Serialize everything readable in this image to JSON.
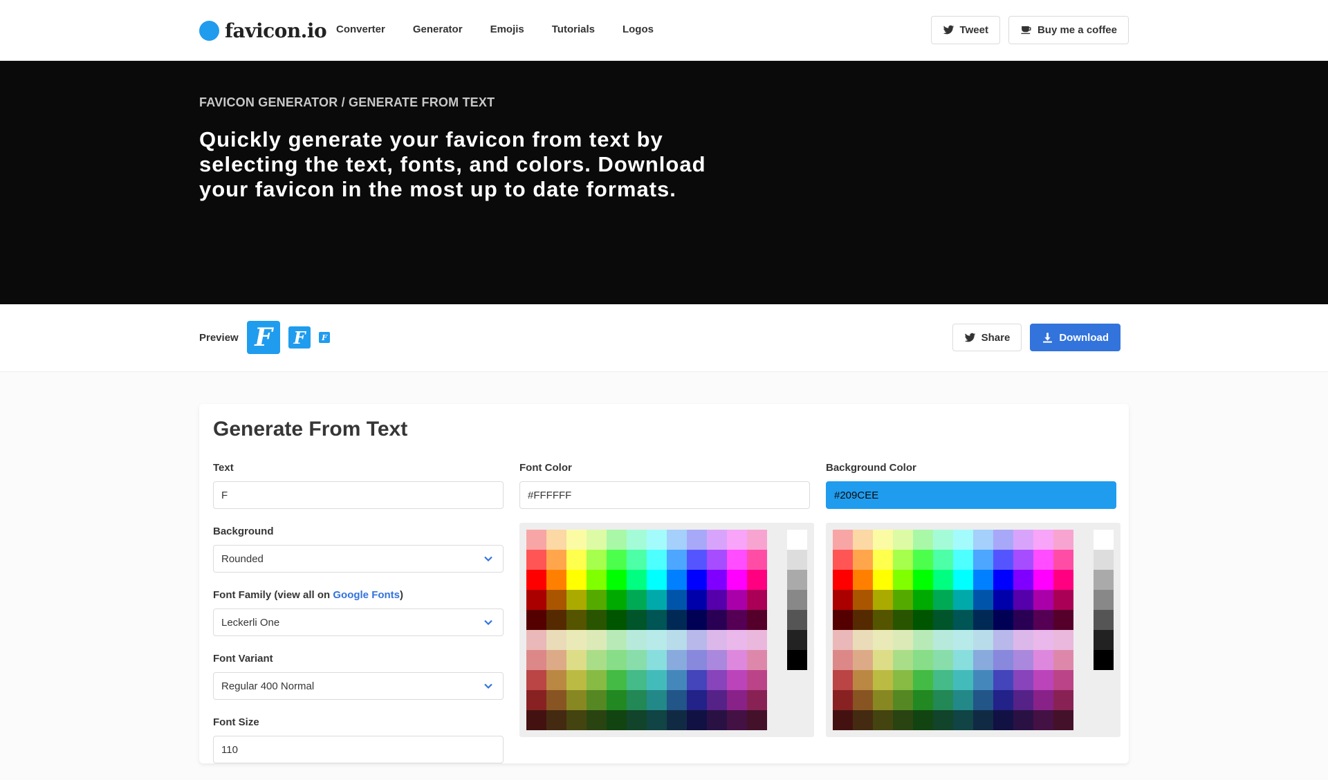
{
  "nav": {
    "brand": "favicon.io",
    "links": [
      "Converter",
      "Generator",
      "Emojis",
      "Tutorials",
      "Logos"
    ],
    "tweet": "Tweet",
    "coffee": "Buy me a coffee"
  },
  "hero": {
    "breadcrumb": "FAVICON GENERATOR / GENERATE FROM TEXT",
    "title": "Quickly generate your favicon from text by selecting the text, fonts, and colors. Download your favicon in the most up to date formats."
  },
  "preview": {
    "label": "Preview",
    "glyph": "F",
    "share": "Share",
    "download": "Download"
  },
  "form": {
    "title": "Generate From Text",
    "text_label": "Text",
    "text_value": "F",
    "background_label": "Background",
    "background_value": "Rounded",
    "font_family_label_pre": "Font Family (view all on ",
    "font_family_link": "Google Fonts",
    "font_family_label_post": ")",
    "font_family_value": "Leckerli One",
    "font_variant_label": "Font Variant",
    "font_variant_value": "Regular 400 Normal",
    "font_size_label": "Font Size",
    "font_size_value": "110",
    "font_color_label": "Font Color",
    "font_color_value": "#FFFFFF",
    "bg_color_label": "Background Color",
    "bg_color_value": "#209CEE"
  },
  "colors": {
    "accent": "#209cee",
    "primary": "#3273dc",
    "hero_bg": "#0a0a0a"
  },
  "palette": {
    "rows": [
      [
        "#f8a5a5",
        "#fbd8a4",
        "#fbfba4",
        "#ddfba4",
        "#a8f8a8",
        "#a4fbd8",
        "#a4fbfb",
        "#a4d0fb",
        "#a8a8f8",
        "#d8a4fb",
        "#f8a4f8",
        "#f8a4d0"
      ],
      [
        "#ff5555",
        "#ffa64d",
        "#ffff4d",
        "#a6ff4d",
        "#4dff4d",
        "#4dffa6",
        "#4dffff",
        "#4da6ff",
        "#5555ff",
        "#a64dff",
        "#ff4dff",
        "#ff4da6"
      ],
      [
        "#ff0000",
        "#ff8000",
        "#ffff00",
        "#80ff00",
        "#00ff00",
        "#00ff80",
        "#00ffff",
        "#0080ff",
        "#0000ff",
        "#8000ff",
        "#ff00ff",
        "#ff0080"
      ],
      [
        "#aa0000",
        "#aa5500",
        "#aaaa00",
        "#55aa00",
        "#00aa00",
        "#00aa55",
        "#00aaaa",
        "#0055aa",
        "#0000aa",
        "#5500aa",
        "#aa00aa",
        "#aa0055"
      ],
      [
        "#550000",
        "#552a00",
        "#555500",
        "#2a5500",
        "#005500",
        "#00552a",
        "#005555",
        "#002a55",
        "#000055",
        "#2a0055",
        "#550055",
        "#55002a"
      ],
      [
        "#eab8b8",
        "#eadcb8",
        "#eaeab8",
        "#dceab8",
        "#b8eab8",
        "#b8eadc",
        "#b8eaea",
        "#b8dcea",
        "#b8b8ea",
        "#dcb8ea",
        "#eab8ea",
        "#eab8dc"
      ],
      [
        "#dd8888",
        "#ddaa88",
        "#dddd88",
        "#aadd88",
        "#88dd88",
        "#88ddaa",
        "#88dddd",
        "#88aadd",
        "#8888dd",
        "#aa88dd",
        "#dd88dd",
        "#dd88aa"
      ],
      [
        "#bb4444",
        "#bb8844",
        "#bbbb44",
        "#88bb44",
        "#44bb44",
        "#44bb88",
        "#44bbbb",
        "#4488bb",
        "#4444bb",
        "#8844bb",
        "#bb44bb",
        "#bb4488"
      ],
      [
        "#882222",
        "#885522",
        "#888822",
        "#558822",
        "#228822",
        "#228855",
        "#228888",
        "#225588",
        "#222288",
        "#552288",
        "#882288",
        "#882255"
      ],
      [
        "#441111",
        "#442a11",
        "#444411",
        "#2a4411",
        "#114411",
        "#11442a",
        "#114444",
        "#112a44",
        "#111144",
        "#2a1144",
        "#441144",
        "#44112a"
      ]
    ],
    "grays": [
      "#ffffff",
      "#dddddd",
      "#aaaaaa",
      "#888888",
      "#555555",
      "#222222",
      "#000000"
    ]
  }
}
